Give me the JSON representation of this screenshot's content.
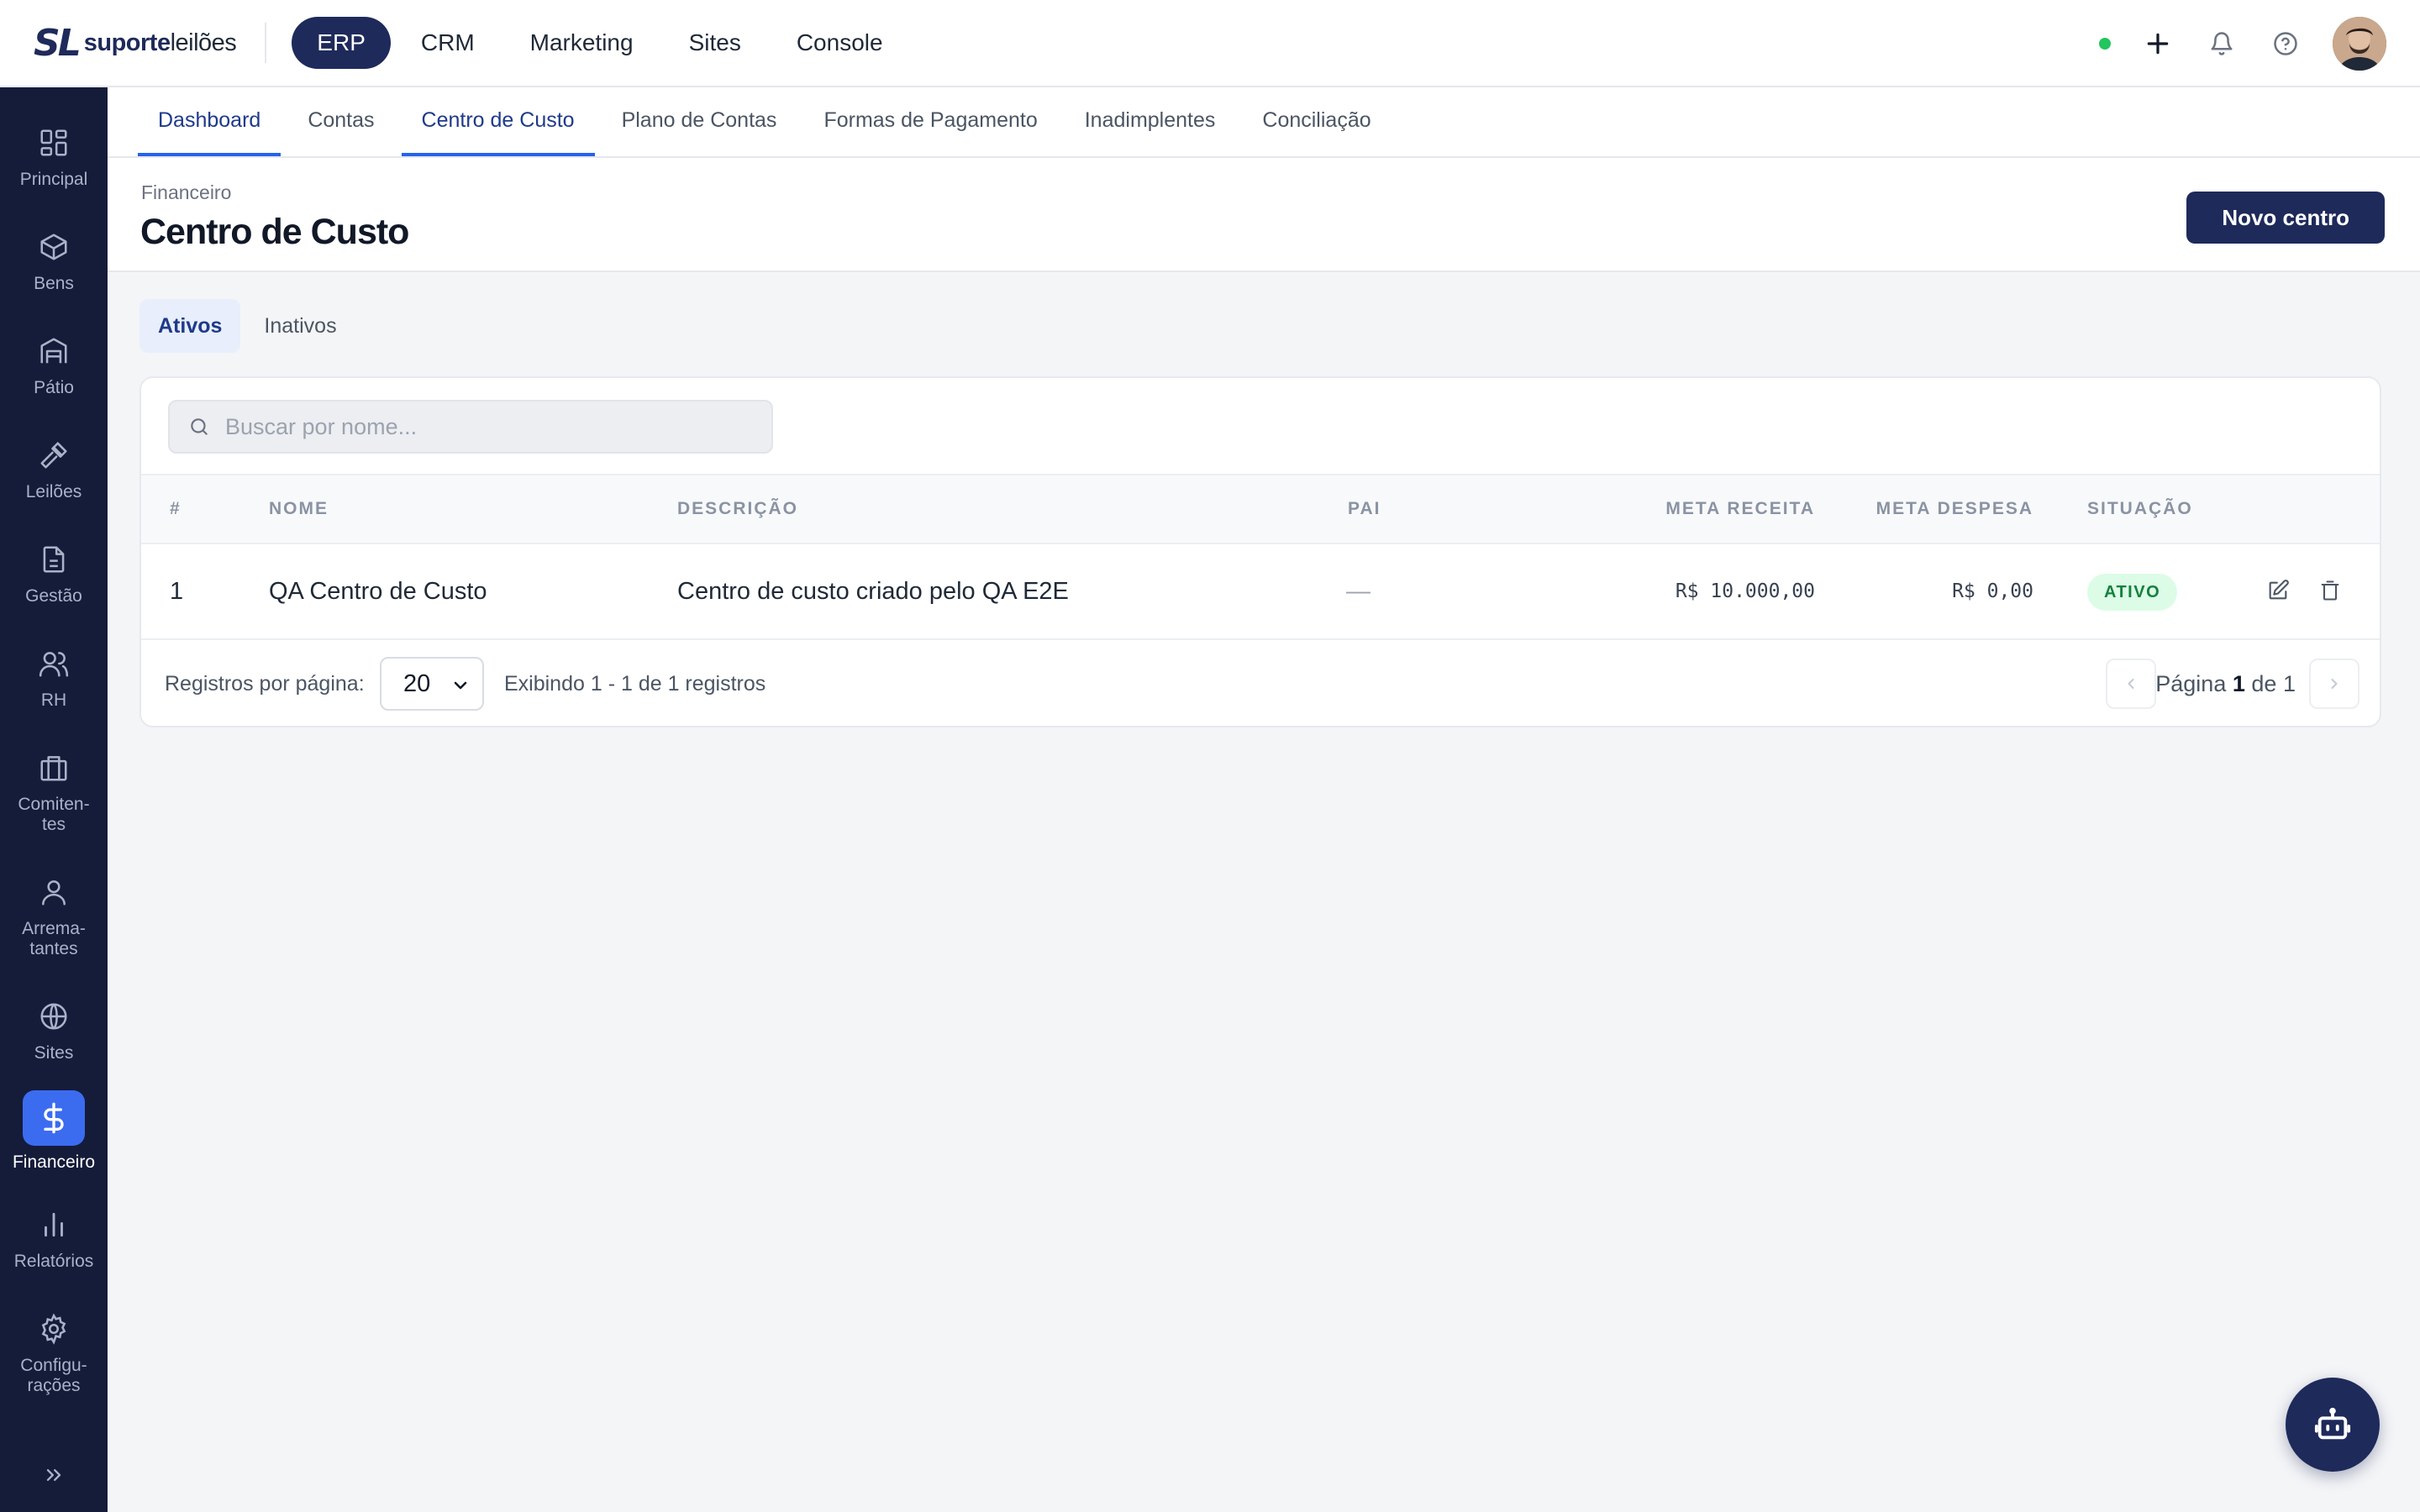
{
  "brand": {
    "mark": "SL",
    "name_bold": "suporte",
    "name_light": "leilões"
  },
  "topnav": {
    "items": [
      "ERP",
      "CRM",
      "Marketing",
      "Sites",
      "Console"
    ],
    "active": "ERP"
  },
  "topbar_icons": [
    "status-online",
    "plus-icon",
    "bell-icon",
    "help-icon",
    "avatar"
  ],
  "sidebar": {
    "items": [
      {
        "label": "Principal",
        "icon": "grid-icon"
      },
      {
        "label": "Bens",
        "icon": "box-icon"
      },
      {
        "label": "Pátio",
        "icon": "warehouse-icon"
      },
      {
        "label": "Leilões",
        "icon": "gavel-icon"
      },
      {
        "label": "Gestão",
        "icon": "document-icon"
      },
      {
        "label": "RH",
        "icon": "users-icon"
      },
      {
        "label": "Comiten-\ntes",
        "icon": "briefcase-icon"
      },
      {
        "label": "Arrema-\ntantes",
        "icon": "user-icon"
      },
      {
        "label": "Sites",
        "icon": "globe-icon"
      },
      {
        "label": "Financeiro",
        "icon": "dollar-icon",
        "active": true
      },
      {
        "label": "Relatórios",
        "icon": "bar-chart-icon"
      },
      {
        "label": "Configu-\nrações",
        "icon": "gear-icon"
      }
    ]
  },
  "subtabs": {
    "items": [
      "Dashboard",
      "Contas",
      "Centro de Custo",
      "Plano de Contas",
      "Formas de Pagamento",
      "Inadimplentes",
      "Conciliação"
    ],
    "active": "Centro de Custo"
  },
  "header": {
    "breadcrumb": "Financeiro",
    "title": "Centro de Custo",
    "new_button": "Novo centro"
  },
  "filters": {
    "items": [
      "Ativos",
      "Inativos"
    ],
    "active": "Ativos"
  },
  "search": {
    "placeholder": "Buscar por nome...",
    "value": ""
  },
  "table": {
    "columns": [
      "#",
      "NOME",
      "DESCRIÇÃO",
      "PAI",
      "META RECEITA",
      "META DESPESA",
      "SITUAÇÃO"
    ],
    "rows": [
      {
        "index": "1",
        "nome": "QA Centro de Custo",
        "descricao": "Centro de custo criado pelo QA E2E",
        "pai": "—",
        "meta_receita": "R$ 10.000,00",
        "meta_despesa": "R$ 0,00",
        "situacao": "ATIVO"
      }
    ]
  },
  "footer": {
    "per_page_label": "Registros por página:",
    "per_page_value": "20",
    "showing": "Exibindo 1 - 1 de 1 registros",
    "page_prefix": "Página",
    "page_current": "1",
    "page_sep": "de",
    "page_total": "1"
  },
  "colors": {
    "sidebar_bg": "#151c3a",
    "primary": "#1e2a5a",
    "accent": "#2563eb",
    "active_icon_bg": "#3b6cf0",
    "success": "#22c55e"
  }
}
